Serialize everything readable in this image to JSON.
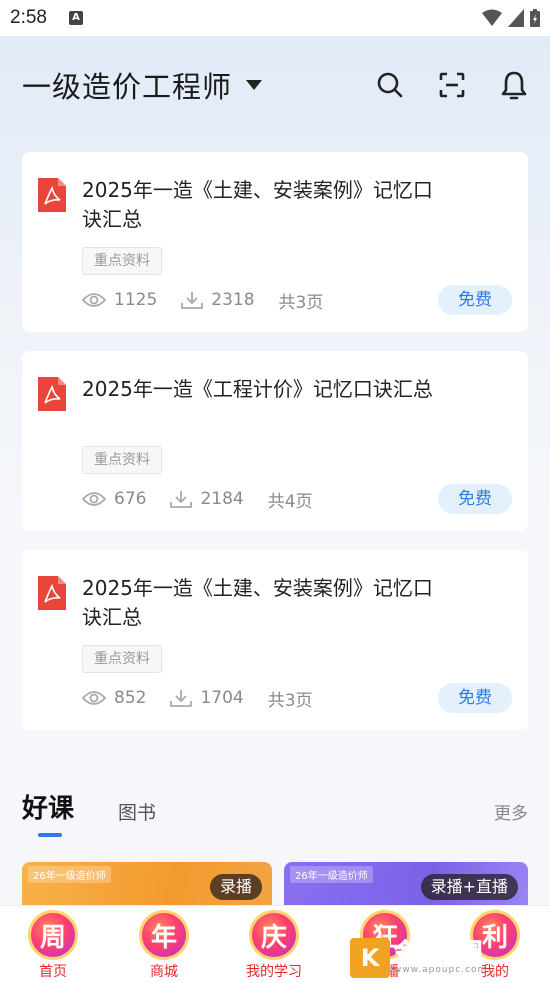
{
  "status": {
    "time": "2:58",
    "a_icon": "A"
  },
  "header": {
    "title": "一级造价工程师"
  },
  "documents": [
    {
      "title": "2025年一造《土建、安装案例》记忆口诀汇总",
      "tag": "重点资料",
      "views": "1125",
      "downloads": "2318",
      "pages": "共3页",
      "price": "免费"
    },
    {
      "title": "2025年一造《工程计价》记忆口诀汇总",
      "tag": "重点资料",
      "views": "676",
      "downloads": "2184",
      "pages": "共4页",
      "price": "免费"
    },
    {
      "title": "2025年一造《土建、安装案例》记忆口诀汇总",
      "tag": "重点资料",
      "views": "852",
      "downloads": "1704",
      "pages": "共3页",
      "price": "免费"
    }
  ],
  "section": {
    "active_tab": "好课",
    "tab2": "图书",
    "more": "更多"
  },
  "courses": [
    {
      "label": "26年一级造价师",
      "badge": "录播"
    },
    {
      "label": "26年一级造价师",
      "badge": "录播+直播"
    }
  ],
  "bottom_nav": [
    {
      "badge": "周",
      "label": "首页"
    },
    {
      "badge": "年",
      "label": "商城"
    },
    {
      "badge": "庆",
      "label": "我的学习"
    },
    {
      "badge": "狂",
      "label": "直播"
    },
    {
      "badge": "利",
      "label": "我的"
    }
  ],
  "watermark": {
    "logo": "K",
    "name": "金软件园",
    "url": "www.apoupc.com"
  },
  "colors": {
    "accent": "#2d7ee0",
    "pdf_red": "#e8463a",
    "free_bg": "#e4f0fc"
  }
}
